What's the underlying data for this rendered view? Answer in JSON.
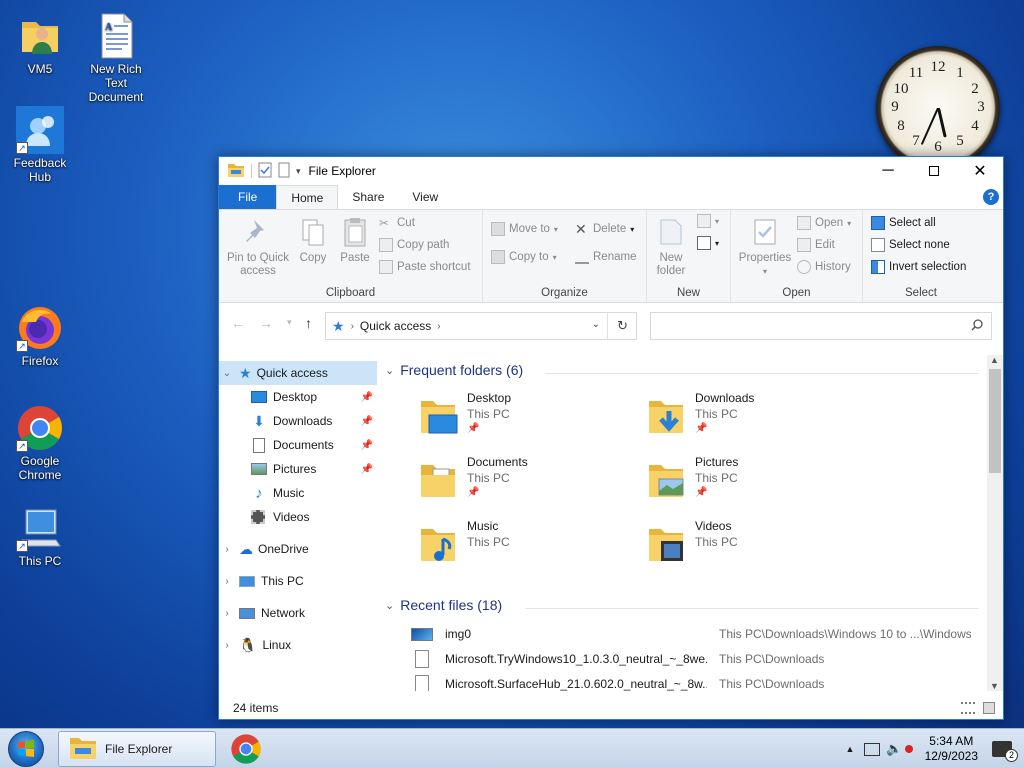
{
  "desktop": {
    "icons": [
      {
        "label": "VM5",
        "icon": "user-folder-icon"
      },
      {
        "label": "New Rich Text Document",
        "icon": "rich-text-document-icon"
      },
      {
        "label": "Feedback Hub",
        "icon": "feedback-hub-icon"
      },
      {
        "label": "Firefox",
        "icon": "firefox-icon"
      },
      {
        "label": "Google Chrome",
        "icon": "chrome-icon"
      },
      {
        "label": "This PC",
        "icon": "computer-icon"
      }
    ],
    "clock_numbers": [
      "12",
      "1",
      "2",
      "3",
      "4",
      "5",
      "6",
      "7",
      "8",
      "9",
      "10",
      "11"
    ]
  },
  "window": {
    "title": "File Explorer",
    "tabs": {
      "file": "File",
      "home": "Home",
      "share": "Share",
      "view": "View"
    },
    "help": "?",
    "ribbon": {
      "clipboard": {
        "label": "Clipboard",
        "pin": "Pin to Quick access",
        "copy": "Copy",
        "paste": "Paste",
        "cut": "Cut",
        "copy_path": "Copy path",
        "paste_shortcut": "Paste shortcut"
      },
      "organize": {
        "label": "Organize",
        "move_to": "Move to",
        "copy_to": "Copy to",
        "delete": "Delete",
        "rename": "Rename"
      },
      "new": {
        "label": "New",
        "new_folder": "New folder"
      },
      "open": {
        "label": "Open",
        "properties": "Properties",
        "open": "Open",
        "edit": "Edit",
        "history": "History"
      },
      "select": {
        "label": "Select",
        "select_all": "Select all",
        "select_none": "Select none",
        "invert": "Invert selection"
      }
    },
    "address": {
      "path": "Quick access"
    },
    "nav": {
      "quick_access": "Quick access",
      "items": [
        {
          "label": "Desktop",
          "pinned": true
        },
        {
          "label": "Downloads",
          "pinned": true
        },
        {
          "label": "Documents",
          "pinned": true
        },
        {
          "label": "Pictures",
          "pinned": true
        },
        {
          "label": "Music",
          "pinned": false
        },
        {
          "label": "Videos",
          "pinned": false
        }
      ],
      "roots": [
        "OneDrive",
        "This PC",
        "Network",
        "Linux"
      ]
    },
    "frequent": {
      "heading": "Frequent folders (6)",
      "folders": [
        {
          "name": "Desktop",
          "location": "This PC",
          "pinned": true
        },
        {
          "name": "Downloads",
          "location": "This PC",
          "pinned": true
        },
        {
          "name": "Documents",
          "location": "This PC",
          "pinned": true
        },
        {
          "name": "Pictures",
          "location": "This PC",
          "pinned": true
        },
        {
          "name": "Music",
          "location": "This PC",
          "pinned": false
        },
        {
          "name": "Videos",
          "location": "This PC",
          "pinned": false
        }
      ]
    },
    "recent": {
      "heading": "Recent files (18)",
      "files": [
        {
          "name": "img0",
          "location": "This PC\\Downloads\\Windows 10 to ...\\Windows"
        },
        {
          "name": "Microsoft.TryWindows10_1.0.3.0_neutral_~_8we...",
          "location": "This PC\\Downloads"
        },
        {
          "name": "Microsoft.SurfaceHub_21.0.602.0_neutral_~_8w...",
          "location": "This PC\\Downloads"
        }
      ]
    },
    "status": "24 items"
  },
  "taskbar": {
    "file_explorer": "File Explorer",
    "time": "5:34 AM",
    "date": "12/9/2023",
    "notifications": "2"
  },
  "colors": {
    "accent": "#1a6fd1",
    "selection": "#cce4f7",
    "heading": "#1e3287"
  }
}
